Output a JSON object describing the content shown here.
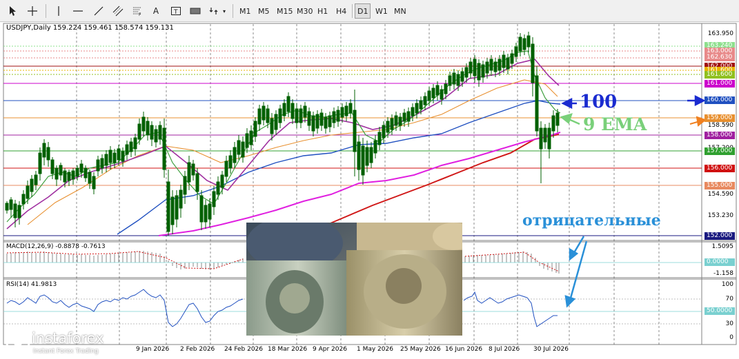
{
  "toolbar": {
    "tools": [
      "cursor-icon",
      "crosshair-icon",
      "vertical-line-icon",
      "horizontal-line-icon",
      "trendline-icon",
      "channel-icon",
      "fibonacci-icon",
      "text-icon",
      "label-icon",
      "rectangle-icon",
      "arrows-icon",
      "dropdown-icon"
    ],
    "timeframes": [
      "M1",
      "M5",
      "M15",
      "M30",
      "H1",
      "H4",
      "D1",
      "W1",
      "MN"
    ],
    "active_timeframe": "D1"
  },
  "chart": {
    "header": "USDJPY,Daily  159.224 159.461 158.574 159.131",
    "price_axis": [
      "163.950",
      "158.590",
      "154.590",
      "153.230",
      "157.200"
    ],
    "levels": [
      {
        "label": "163.240",
        "color": "#8ee08e"
      },
      {
        "label": "163.000",
        "color": "#e88a8a"
      },
      {
        "label": "162.630",
        "color": "#e88a8a"
      },
      {
        "label": "162.000",
        "color": "#a01010"
      },
      {
        "label": "161.600",
        "color": "#e8b400"
      },
      {
        "label": "161.600",
        "color": "#90c020"
      },
      {
        "label": "161.000",
        "color": "#cc00cc"
      },
      {
        "label": "160.000",
        "color": "#2050c0"
      },
      {
        "label": "159.000",
        "color": "#e89030"
      },
      {
        "label": "158.000",
        "color": "#a020a0"
      },
      {
        "label": "157.000",
        "color": "#30a030"
      },
      {
        "label": "156.000",
        "color": "#d01010"
      },
      {
        "label": "155.000",
        "color": "#e88a60"
      },
      {
        "label": "152.000",
        "color": "#1a1a80"
      }
    ],
    "annotation_100": "100",
    "annotation_ema": "9 EMA",
    "annotation_negative": "отрицательные",
    "date_axis": [
      "9 Jan 2026",
      "2 Feb 2026",
      "24 Feb 2026",
      "18 Mar 2026",
      "9 Apr 2026",
      "1 May 2026",
      "25 May 2026",
      "16 Jun 2026",
      "8 Jul 2026",
      "30 Jul 2026"
    ]
  },
  "macd": {
    "header": "MACD(12,26,9) -0.8878 -0.7613",
    "axis": [
      "1.5095",
      "0.0000",
      "-1.158"
    ]
  },
  "rsi": {
    "header": "RSI(14) 41.9813",
    "axis": [
      "100",
      "70",
      "50.0000",
      "30",
      "0"
    ]
  },
  "brand": {
    "name": "instaforex",
    "tagline": "Instant Forex Trading"
  },
  "colors": {
    "annotation_blue": "#1a2bd0",
    "annotation_green": "#7ad07a",
    "annotation_sky": "#2a90d8",
    "orange_arrow": "#f08020"
  }
}
